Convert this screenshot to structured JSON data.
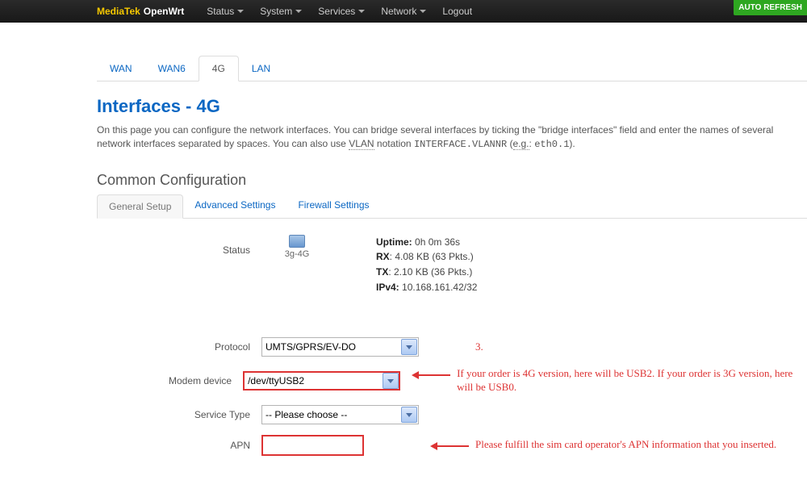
{
  "nav": {
    "brand1": "MediaTek",
    "brand2": "OpenWrt",
    "items": [
      "Status",
      "System",
      "Services",
      "Network",
      "Logout"
    ],
    "autorefresh": "AUTO REFRESH"
  },
  "ifTabs": [
    "WAN",
    "WAN6",
    "4G",
    "LAN"
  ],
  "ifTabActive": 2,
  "title": "Interfaces - 4G",
  "intro": {
    "p1a": "On this page you can configure the network interfaces. You can bridge several interfaces by ticking the \"bridge interfaces\" field and enter the names of several network interfaces separated by spaces. You can also use ",
    "vlan": "VLAN",
    "p1b": " notation ",
    "code1": "INTERFACE.VLANNR",
    "p1c": " (",
    "eg": "e.g.",
    "p1d": ": ",
    "code2": "eth0.1",
    "p1e": ")."
  },
  "subheading": "Common Configuration",
  "secTabs": [
    "General Setup",
    "Advanced Settings",
    "Firewall Settings"
  ],
  "secTabActive": 0,
  "statusLabel": "Status",
  "ifaceName": "3g-4G",
  "stats": {
    "uptimeLabel": "Uptime:",
    "uptime": "0h 0m 36s",
    "rxLabel": "RX",
    "rx": ": 4.08 KB (63 Pkts.)",
    "txLabel": "TX",
    "tx": ": 2.10 KB (36 Pkts.)",
    "ipLabel": "IPv4:",
    "ip": "10.168.161.42/32"
  },
  "fields": {
    "protocolLabel": "Protocol",
    "protocolValue": "UMTS/GPRS/EV-DO",
    "modemLabel": "Modem device",
    "modemValue": "/dev/ttyUSB2",
    "serviceLabel": "Service Type",
    "servicePlaceholder": "-- Please choose --",
    "apnLabel": "APN",
    "apnValue": ""
  },
  "annot": {
    "step": "3.",
    "modem": "If your order is 4G version, here will be USB2. If your order is 3G version, here will be USB0.",
    "apn": "Please fulfill the sim card operator's APN information that you inserted."
  }
}
